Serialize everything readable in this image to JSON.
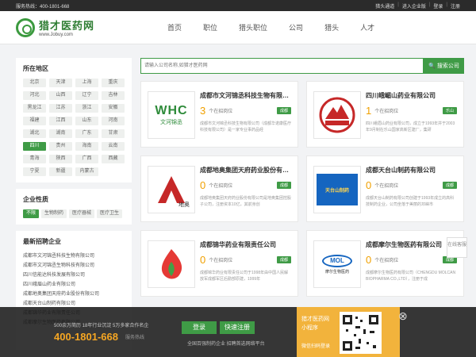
{
  "topbar": {
    "hotline": "服务热线：400-1801-668",
    "links": [
      "猎头通道",
      "进入企业版",
      "登录",
      "注册"
    ]
  },
  "logo": {
    "cn": "猎才医药网",
    "en": "www.Jobuy.com"
  },
  "nav": [
    "首页",
    "职位",
    "猎头职位",
    "公司",
    "猎头",
    "人才"
  ],
  "sidebar": {
    "region_title": "所在地区",
    "regions": [
      "北京",
      "天津",
      "上海",
      "重庆",
      "河北",
      "山西",
      "辽宁",
      "吉林",
      "黑龙江",
      "江苏",
      "浙江",
      "安徽",
      "福建",
      "江西",
      "山东",
      "河南",
      "湖北",
      "湖南",
      "广东",
      "甘肃",
      "四川",
      "贵州",
      "海南",
      "云南",
      "青海",
      "陕西",
      "广西",
      "西藏",
      "宁夏",
      "新疆",
      "内蒙古"
    ],
    "active_region": "四川",
    "nature_title": "企业性质",
    "natures": [
      "不限",
      "生物制药",
      "医疗器械",
      "医疗卫生"
    ],
    "recent_title": "最新招聘企业",
    "recent": [
      "成都市文河锦丞科技生物有限公司",
      "成都市文河锦丞生物科技有限公司",
      "四川信能达科技发展有限公司",
      "四川峨眉山药业有限公司",
      "成都地奥集团天府药业股份有限公司",
      "成都天台山制药有限公司",
      "成都锦华药业有限责任公司",
      "成都摩尔生物医药有限公司"
    ]
  },
  "search": {
    "placeholder": "请输入公司名称,如猎才医药网",
    "button": "搜索公司"
  },
  "cards": [
    {
      "name": "成都市文河锦丞科技生物有限公司",
      "count": "3",
      "count_label": "个在招岗位",
      "loc": "成都",
      "desc": "成都市文河锦丞科技生物有限公司（成都华诺康医疗科技有限公司）是一家专业事药品经",
      "logo": "whc",
      "logo_text": "文河锦丞"
    },
    {
      "name": "四川峨嵋山药业有限公司",
      "count": "1",
      "count_label": "个在招岗位",
      "loc": "乐山",
      "desc": "四川峨眉山药业有限公司，成立于1993年并于2003年9月制在乐山国家高新区建厂，集研",
      "logo": "emei",
      "logo_text": "EMEISHAN"
    },
    {
      "name": "成都地奥集团天府药业股份有限公司",
      "count": "0",
      "count_label": "个在招岗位",
      "loc": "成都",
      "desc": "成都地奥集团天府药业股份有限公司是地奥集团控股子公司，注册资本10亿，其前身创",
      "logo": "diao",
      "logo_text": "地奥"
    },
    {
      "name": "成都天台山制药有限公司",
      "count": "0",
      "count_label": "个在招岗位",
      "loc": "成都",
      "desc": "成都天台山制药有限公司创建于1993年成立的高科技制药企业，公司坐落于美丽的邛崃市",
      "logo": "tts",
      "logo_text": "天台山制药"
    },
    {
      "name": "成都锦华药业有限责任公司",
      "count": "0",
      "count_label": "个在招岗位",
      "loc": "成都",
      "desc": "成都锦华药业有限责任公司于1998年由中国人民解放军成都军区后勤部原建，1999年",
      "logo": "jh",
      "logo_text": ""
    },
    {
      "name": "成都摩尔生物医药有限公司",
      "count": "0",
      "count_label": "个在招岗位",
      "loc": "成都",
      "desc": "成都摩尔生物医药有限公司（CHENGDU MOLCAN BIOPHARMA CO.,LTD），注册于成",
      "logo": "mol",
      "logo_text": "摩尔生物医药"
    }
  ],
  "side_button": "在线客服",
  "footer": {
    "tagline": "500余万简历 18年行业沉淀 5万多家合作名企",
    "phone": "400-1801-668",
    "service": "服务热线",
    "login": "登录",
    "register": "快速注册",
    "slogan": "全国百强制药企业 招聘首选网络平台"
  },
  "promo": {
    "t1": "猎才医药网",
    "t2": "小程序",
    "t3": "微信扫码登录"
  },
  "colors": {
    "brand_green": "#3f9b46",
    "count_orange": "#f0a000",
    "promo_yellow": "#f2b33c"
  }
}
